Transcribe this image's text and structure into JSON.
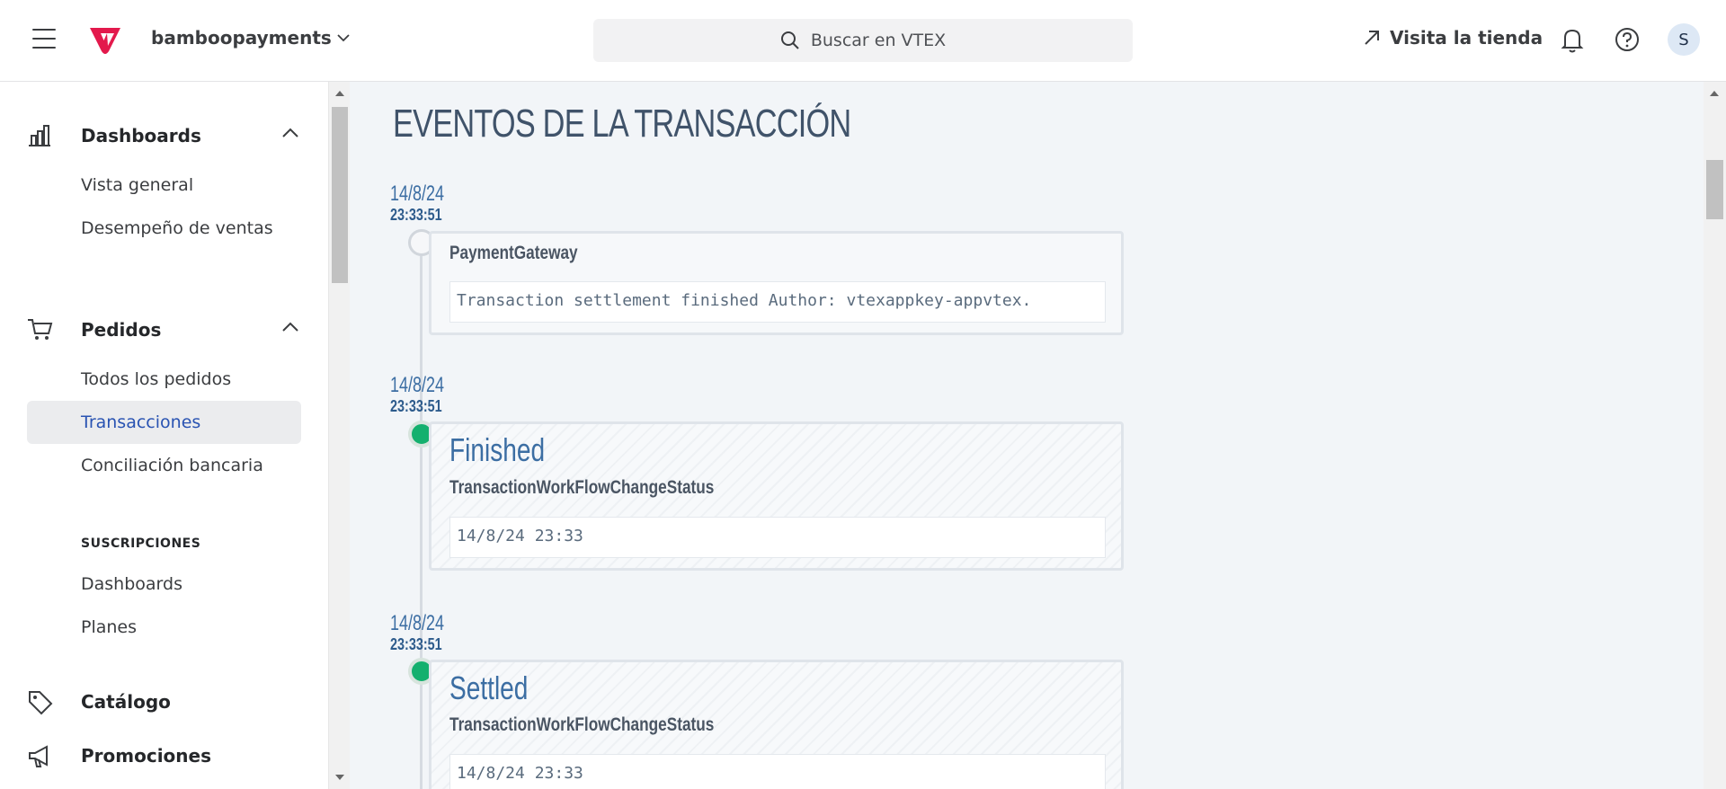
{
  "header": {
    "account_name": "bamboopayments",
    "search_placeholder": "Buscar en VTEX",
    "visit_store": "Visita la tienda",
    "avatar_initial": "S"
  },
  "sidebar": {
    "dashboards": {
      "label": "Dashboards",
      "items": [
        "Vista general",
        "Desempeño de ventas"
      ]
    },
    "orders": {
      "label": "Pedidos",
      "items": [
        "Todos los pedidos",
        "Transacciones",
        "Conciliación bancaria"
      ],
      "active": "Transacciones",
      "subsection_label": "SUSCRIPCIONES",
      "subsection_items": [
        "Dashboards",
        "Planes"
      ]
    },
    "catalog": {
      "label": "Catálogo"
    },
    "promotions": {
      "label": "Promociones"
    }
  },
  "main": {
    "title": "EVENTOS DE LA TRANSACCIÓN",
    "events": [
      {
        "date": "14/8/24",
        "time": "23:33:51",
        "status": "",
        "source": "PaymentGateway",
        "message": "Transaction settlement finished Author: vtexappkey-appvtex.",
        "indicator": "hollow"
      },
      {
        "date": "14/8/24",
        "time": "23:33:51",
        "status": "Finished",
        "source": "TransactionWorkFlowChangeStatus",
        "message": "14/8/24 23:33",
        "indicator": "green"
      },
      {
        "date": "14/8/24",
        "time": "23:33:51",
        "status": "Settled",
        "source": "TransactionWorkFlowChangeStatus",
        "message": "14/8/24 23:33",
        "indicator": "green"
      }
    ]
  },
  "colors": {
    "brand": "#e3194c",
    "active_link": "#2953b2",
    "status_green": "#14b06e",
    "timeline_blue": "#3c6ea3"
  }
}
